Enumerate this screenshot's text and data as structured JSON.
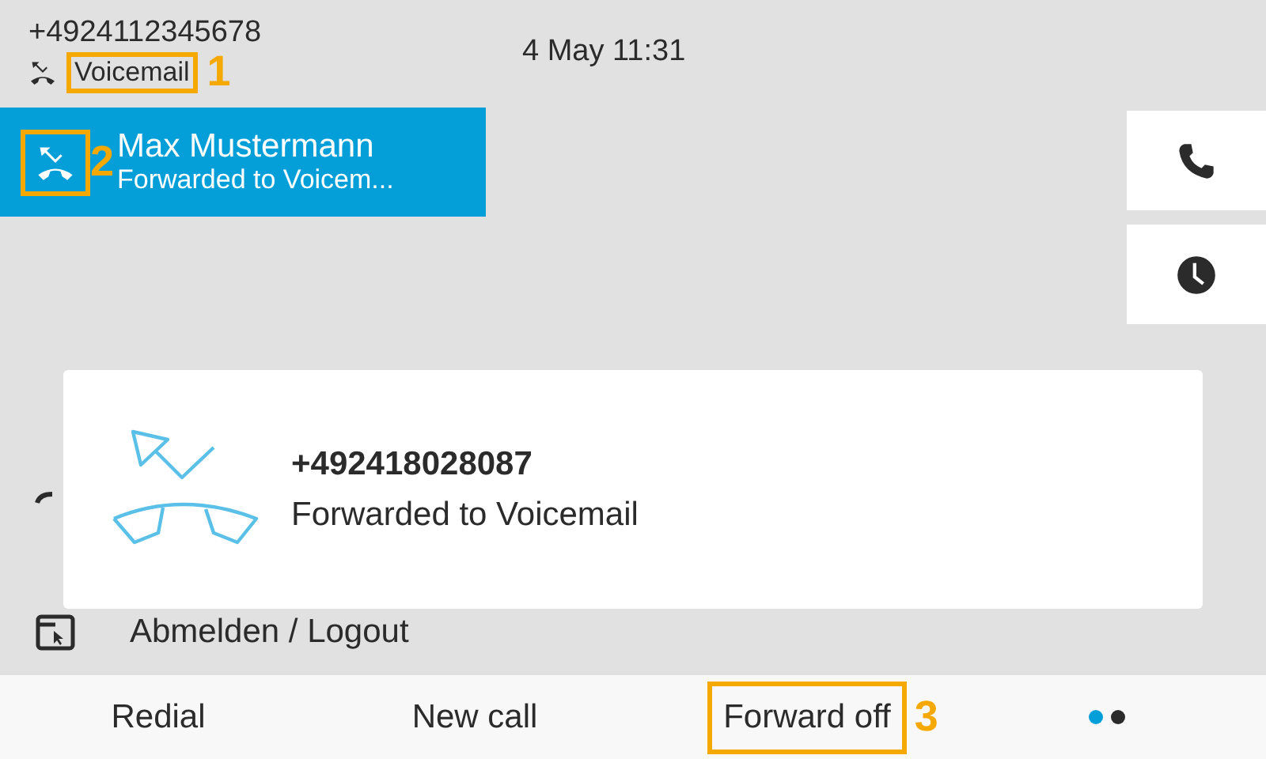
{
  "header": {
    "number": "+4924112345678",
    "status": "Voicemail",
    "status_callout": "1",
    "datetime": "4 May 11:31"
  },
  "line": {
    "name": "Max Mustermann",
    "status": "Forwarded to Voicem...",
    "selected": true,
    "icon_callout": "2"
  },
  "side_buttons": [
    {
      "kind": "call"
    },
    {
      "kind": "recents"
    }
  ],
  "menu": [
    {
      "kind": "handset"
    },
    {
      "kind": "logout",
      "label": "Abmelden / Logout"
    }
  ],
  "popup": {
    "number": "+492418028087",
    "message": "Forwarded to Voicemail"
  },
  "softkeys": [
    {
      "label": "Redial"
    },
    {
      "label": "New call"
    },
    {
      "label": "Forward off",
      "callout": "3"
    }
  ],
  "pages": [
    {
      "selected": true
    },
    {
      "selected": false
    }
  ]
}
